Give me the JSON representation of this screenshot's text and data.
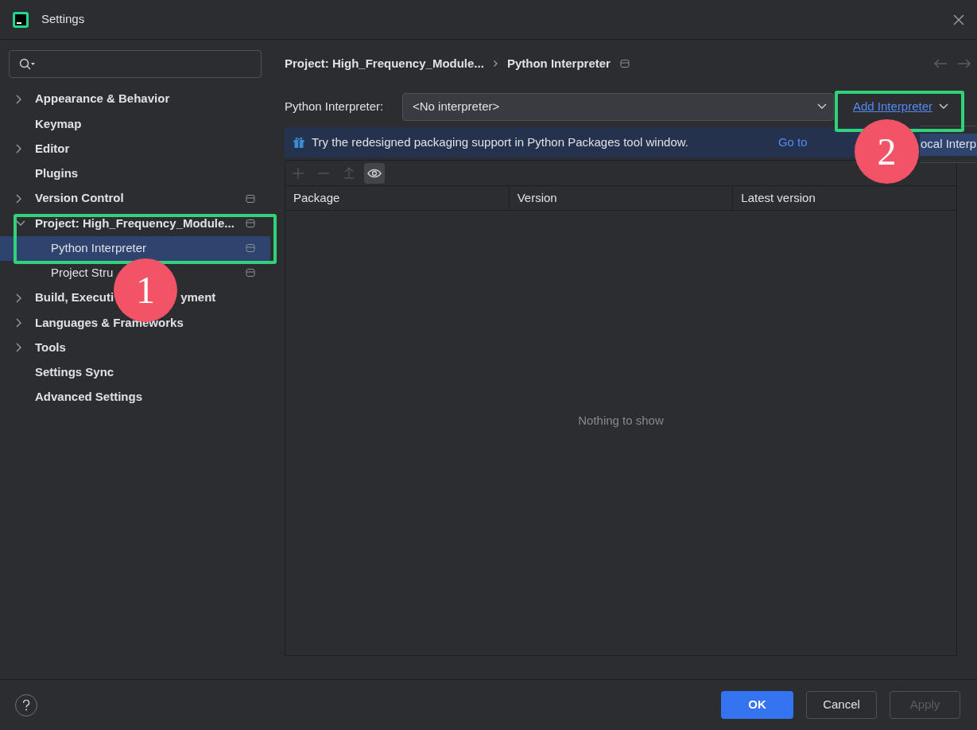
{
  "window": {
    "title": "Settings"
  },
  "sidebar": {
    "items": [
      {
        "label": "Appearance & Behavior",
        "expanded": false,
        "project_level": false,
        "selected": false
      },
      {
        "label": "Keymap",
        "project_level": false,
        "selected": false
      },
      {
        "label": "Editor",
        "expanded": false,
        "project_level": false,
        "selected": false
      },
      {
        "label": "Plugins",
        "project_level": false,
        "selected": false
      },
      {
        "label": "Version Control",
        "expanded": false,
        "project_level": true,
        "selected": false
      },
      {
        "label": "Project: High_Frequency_Module...",
        "expanded": true,
        "project_level": true,
        "selected": false,
        "children": [
          {
            "label": "Python Interpreter",
            "project_level": true,
            "selected": true
          },
          {
            "label": "Project Stru",
            "project_level": true,
            "selected": false
          }
        ]
      },
      {
        "label": "Build, Executi",
        "label_end": "yment",
        "expanded": false,
        "project_level": false,
        "selected": false
      },
      {
        "label": "Languages & Frameworks",
        "expanded": false,
        "project_level": false,
        "selected": false
      },
      {
        "label": "Tools",
        "expanded": false,
        "project_level": false,
        "selected": false
      },
      {
        "label": "Settings Sync",
        "project_level": false,
        "selected": false
      },
      {
        "label": "Advanced Settings",
        "project_level": false,
        "selected": false
      }
    ]
  },
  "breadcrumb": [
    "Project: High_Frequency_Module...",
    "Python Interpreter"
  ],
  "interpreter": {
    "label": "Python Interpreter:",
    "value": "<No interpreter>",
    "add_link": "Add Interpreter"
  },
  "popup": {
    "items": [
      "ocal Interp"
    ]
  },
  "banner": {
    "text": "Try the redesigned packaging support in Python Packages tool window.",
    "link": "Go to"
  },
  "toolbar": [
    {
      "kind": "add",
      "disabled": true,
      "selected": false
    },
    {
      "kind": "remove",
      "disabled": true,
      "selected": false
    },
    {
      "kind": "upgrade",
      "disabled": true,
      "selected": false
    },
    {
      "kind": "eye",
      "disabled": false,
      "selected": true
    }
  ],
  "table": {
    "columns": [
      "Package",
      "Version",
      "Latest version"
    ],
    "empty_text": "Nothing to show"
  },
  "buttons": [
    {
      "label": "OK",
      "kind": "primary",
      "disabled": false
    },
    {
      "label": "Cancel",
      "kind": "normal",
      "disabled": false
    },
    {
      "label": "Apply",
      "kind": "normal",
      "disabled": true
    }
  ],
  "annotations": [
    {
      "label": "1"
    },
    {
      "label": "2"
    }
  ]
}
